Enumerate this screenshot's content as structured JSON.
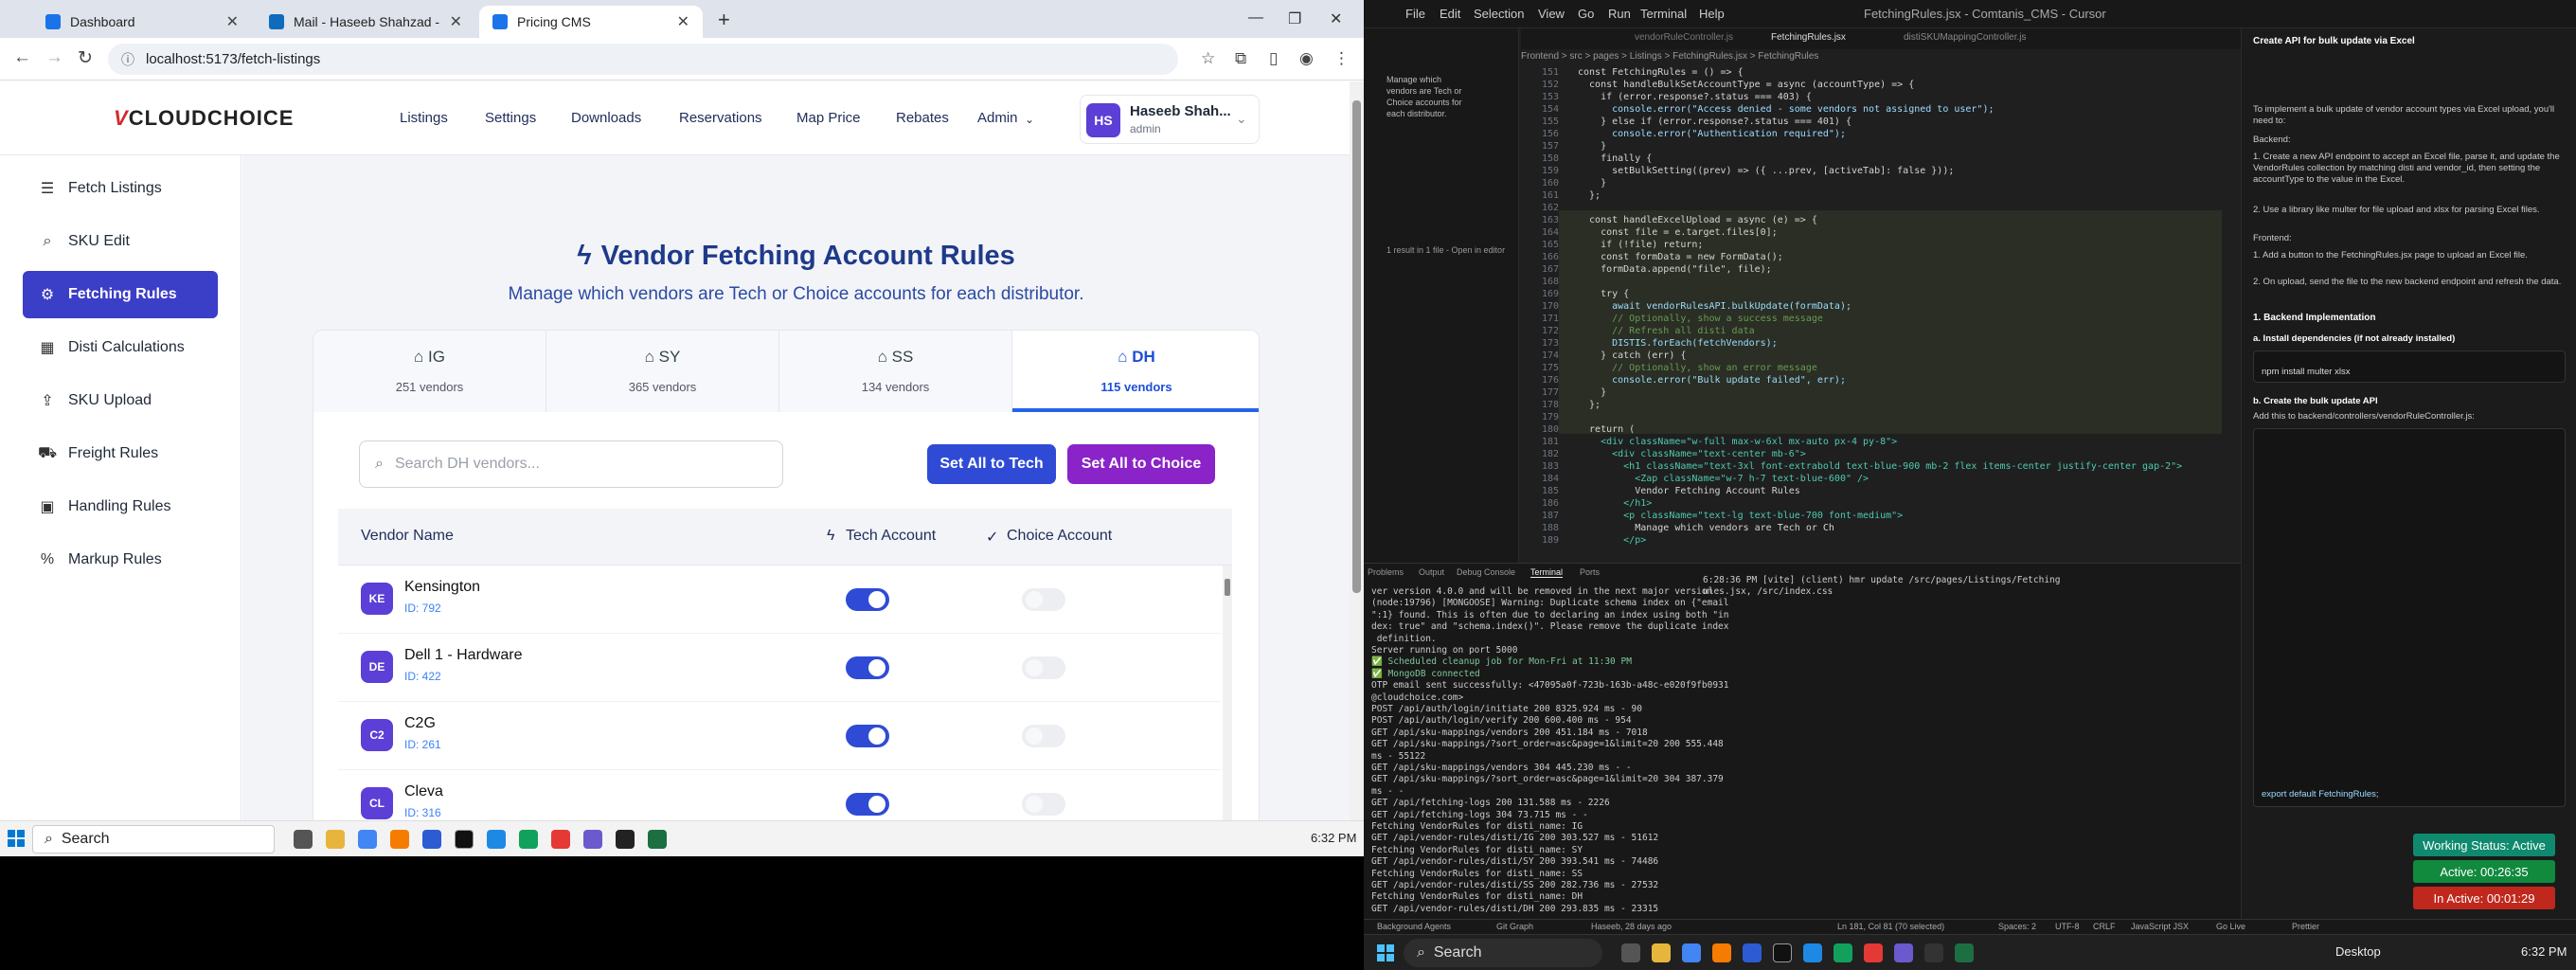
{
  "browser": {
    "tabs": [
      {
        "title": "Dashboard",
        "color": "#1a73e8"
      },
      {
        "title": "Mail - Haseeb Shahzad - Outlo",
        "color": "#0f6cbd"
      },
      {
        "title": "Pricing CMS",
        "color": "#1a73e8"
      }
    ],
    "url": "localhost:5173/fetch-listings"
  },
  "app": {
    "logo_mark": "V",
    "logo_text": "CLOUDCHOICE",
    "nav": [
      "Listings",
      "Settings",
      "Downloads",
      "Reservations",
      "Map Price",
      "Rebates",
      "Admin"
    ],
    "user": {
      "initials": "HS",
      "name": "Haseeb Shah...",
      "role": "admin"
    },
    "sidebar": [
      {
        "label": "Fetch Listings",
        "icon": "list-icon"
      },
      {
        "label": "SKU Edit",
        "icon": "search-icon"
      },
      {
        "label": "Fetching Rules",
        "icon": "gear-icon",
        "active": true
      },
      {
        "label": "Disti Calculations",
        "icon": "calculator-icon"
      },
      {
        "label": "SKU Upload",
        "icon": "upload-icon"
      },
      {
        "label": "Freight Rules",
        "icon": "truck-icon"
      },
      {
        "label": "Handling Rules",
        "icon": "box-icon"
      },
      {
        "label": "Markup Rules",
        "icon": "percent-icon"
      }
    ],
    "page": {
      "title": "Vendor Fetching Account Rules",
      "subtitle": "Manage which vendors are Tech or Choice accounts for each distributor."
    },
    "distributors": [
      {
        "code": "IG",
        "count": "251 vendors"
      },
      {
        "code": "SY",
        "count": "365 vendors"
      },
      {
        "code": "SS",
        "count": "134 vendors"
      },
      {
        "code": "DH",
        "count": "115 vendors",
        "active": true
      }
    ],
    "search_placeholder": "Search DH vendors...",
    "buttons": {
      "tech": "Set All to Tech",
      "choice": "Set All to Choice"
    },
    "table": {
      "col_vendor": "Vendor Name",
      "col_tech": "Tech Account",
      "col_choice": "Choice Account",
      "rows": [
        {
          "initials": "KE",
          "name": "Kensington",
          "id": "ID: 792",
          "tech": true,
          "choice": false
        },
        {
          "initials": "DE",
          "name": "Dell 1 - Hardware",
          "id": "ID: 422",
          "tech": true,
          "choice": false
        },
        {
          "initials": "C2",
          "name": "C2G",
          "id": "ID: 261",
          "tech": true,
          "choice": false
        },
        {
          "initials": "CL",
          "name": "Cleva",
          "id": "ID: 316",
          "tech": true,
          "choice": false
        }
      ]
    }
  },
  "taskbar_left": {
    "search": "Search",
    "time": "6:32 PM"
  },
  "vscode": {
    "menu": [
      "File",
      "Edit",
      "Selection",
      "View",
      "Go",
      "Run",
      "Terminal",
      "Help"
    ],
    "title": "FetchingRules.jsx - Comtanis_CMS - Cursor",
    "tabs": [
      "FetchingRules.jsx",
      "vendorRuleController.js",
      "distiSKUMappingController.js"
    ],
    "breadcrumb": "Frontend > src > pages > Listings > FetchingRules.jsx > FetchingRules",
    "search_panel": [
      "Manage which",
      "vendors are Tech or",
      "Choice accounts for",
      "each distributor.",
      "1 result in 1 file - Open in editor"
    ],
    "code": [
      {
        "n": "151",
        "t": "const FetchingRules = () => {"
      },
      {
        "n": "152",
        "t": "  const handleBulkSetAccountType = async (accountType) => {"
      },
      {
        "n": "153",
        "t": "    if (error.response?.status === 403) {"
      },
      {
        "n": "154",
        "t": "      console.error(\"Access denied - some vendors not assigned to user\");"
      },
      {
        "n": "155",
        "t": "    } else if (error.response?.status === 401) {"
      },
      {
        "n": "156",
        "t": "      console.error(\"Authentication required\");"
      },
      {
        "n": "157",
        "t": "    }"
      },
      {
        "n": "158",
        "t": "    finally {"
      },
      {
        "n": "159",
        "t": "      setBulkSetting((prev) => ({ ...prev, [activeTab]: false }));"
      },
      {
        "n": "160",
        "t": "    }"
      },
      {
        "n": "161",
        "t": "  };"
      },
      {
        "n": "162",
        "t": ""
      },
      {
        "n": "163",
        "t": "  const handleExcelUpload = async (e) => {"
      },
      {
        "n": "164",
        "t": "    const file = e.target.files[0];"
      },
      {
        "n": "165",
        "t": "    if (!file) return;"
      },
      {
        "n": "166",
        "t": "    const formData = new FormData();"
      },
      {
        "n": "167",
        "t": "    formData.append(\"file\", file);"
      },
      {
        "n": "168",
        "t": ""
      },
      {
        "n": "169",
        "t": "    try {"
      },
      {
        "n": "170",
        "t": "      await vendorRulesAPI.bulkUpdate(formData);"
      },
      {
        "n": "171",
        "t": "      // Optionally, show a success message"
      },
      {
        "n": "172",
        "t": "      // Refresh all disti data"
      },
      {
        "n": "173",
        "t": "      DISTIS.forEach(fetchVendors);"
      },
      {
        "n": "174",
        "t": "    } catch (err) {"
      },
      {
        "n": "175",
        "t": "      // Optionally, show an error message"
      },
      {
        "n": "176",
        "t": "      console.error(\"Bulk update failed\", err);"
      },
      {
        "n": "177",
        "t": "    }"
      },
      {
        "n": "178",
        "t": "  };"
      },
      {
        "n": "179",
        "t": ""
      },
      {
        "n": "180",
        "t": "  return ("
      },
      {
        "n": "181",
        "t": "    <div className=\"w-full max-w-6xl mx-auto px-4 py-8\">"
      },
      {
        "n": "182",
        "t": "      <div className=\"text-center mb-6\">"
      },
      {
        "n": "183",
        "t": "        <h1 className=\"text-3xl font-extrabold text-blue-900 mb-2 flex items-center justify-center gap-2\">"
      },
      {
        "n": "184",
        "t": "          <Zap className=\"w-7 h-7 text-blue-600\" />"
      },
      {
        "n": "185",
        "t": "          Vendor Fetching Account Rules"
      },
      {
        "n": "186",
        "t": "        </h1>"
      },
      {
        "n": "187",
        "t": "        <p className=\"text-lg text-blue-700 font-medium\">"
      },
      {
        "n": "188",
        "t": "          Manage which vendors are Tech or Ch"
      },
      {
        "n": "189",
        "t": "        </p>"
      }
    ],
    "panel_tabs": [
      "Problems",
      "Output",
      "Debug Console",
      "Terminal",
      "Ports"
    ],
    "terminal": [
      "ver version 4.0.0 and will be removed in the next major version",
      "(node:19796) [MONGOOSE] Warning: Duplicate schema index on {\"email",
      "\":1} found. This is often due to declaring an index using both \"in",
      "dex: true\" and \"schema.index()\". Please remove the duplicate index",
      " definition.",
      "Server running on port 5000",
      "✅ Scheduled cleanup job for Mon-Fri at 11:30 PM",
      "✅ MongoDB connected",
      "OTP email sent successfully: <47095a0f-723b-163b-a48c-e020f9fb0931",
      "@cloudchoice.com>",
      "POST /api/auth/login/initiate 200 8325.924 ms - 90",
      "POST /api/auth/login/verify 200 600.400 ms - 954",
      "GET /api/sku-mappings/vendors 200 451.184 ms - 7018",
      "GET /api/sku-mappings/?sort_order=asc&page=1&limit=20 200 555.448",
      "ms - 55122",
      "GET /api/sku-mappings/vendors 304 445.230 ms - -",
      "GET /api/sku-mappings/?sort_order=asc&page=1&limit=20 304 387.379",
      "ms - -",
      "GET /api/fetching-logs 200 131.588 ms - 2226",
      "GET /api/fetching-logs 304 73.715 ms - -",
      "Fetching VendorRules for disti_name: IG",
      "GET /api/vendor-rules/disti/IG 200 303.527 ms - 51612",
      "Fetching VendorRules for disti_name: SY",
      "GET /api/vendor-rules/disti/SY 200 393.541 ms - 74486",
      "Fetching VendorRules for disti_name: SS",
      "GET /api/vendor-rules/disti/SS 200 282.736 ms - 27532",
      "Fetching VendorRules for disti_name: DH",
      "GET /api/vendor-rules/disti/DH 200 293.835 ms - 23315"
    ],
    "terminal_right": "6:28:36 PM [vite] (client) hmr update /src/pages/Listings/Fetching\nules.jsx, /src/index.css",
    "chat_title": "Create API for bulk update via Excel",
    "chat": [
      "To implement a bulk update of vendor account types via Excel upload, you'll need to:",
      "Backend:",
      "1. Create a new API endpoint to accept an Excel file, parse it, and update the VendorRules collection by matching disti and vendor_id, then setting the accountType to the value in the Excel.",
      "2. Use a library like multer for file upload and xlsx for parsing Excel files.",
      "Frontend:",
      "1. Add a button to the FetchingRules.jsx page to upload an Excel file.",
      "2. On upload, send the file to the new backend endpoint and refresh the data.",
      "1. Backend Implementation",
      "a. Install dependencies (if not already installed)",
      "npm install multer xlsx",
      "b. Create the bulk update API",
      "Add this to backend/controllers/vendorRuleController.js:",
      "export default FetchingRules;"
    ],
    "badges": [
      {
        "text": "Working Status: Active",
        "color": "#0f8a6e"
      },
      {
        "text": "Active: 00:26:35",
        "color": "#118a3e"
      },
      {
        "text": "In Active: 00:01:29",
        "color": "#c0281d"
      }
    ],
    "status": [
      "Background Agents",
      "Git Graph",
      "Haseeb, 28 days ago",
      "Ln 181, Col 81 (70 selected)",
      "Spaces: 2",
      "UTF-8",
      "CRLF",
      "JavaScript JSX",
      "Go Live",
      "Prettier"
    ]
  },
  "taskbar_right": {
    "search": "Search",
    "desktop": "Desktop",
    "time": "6:32 PM"
  }
}
